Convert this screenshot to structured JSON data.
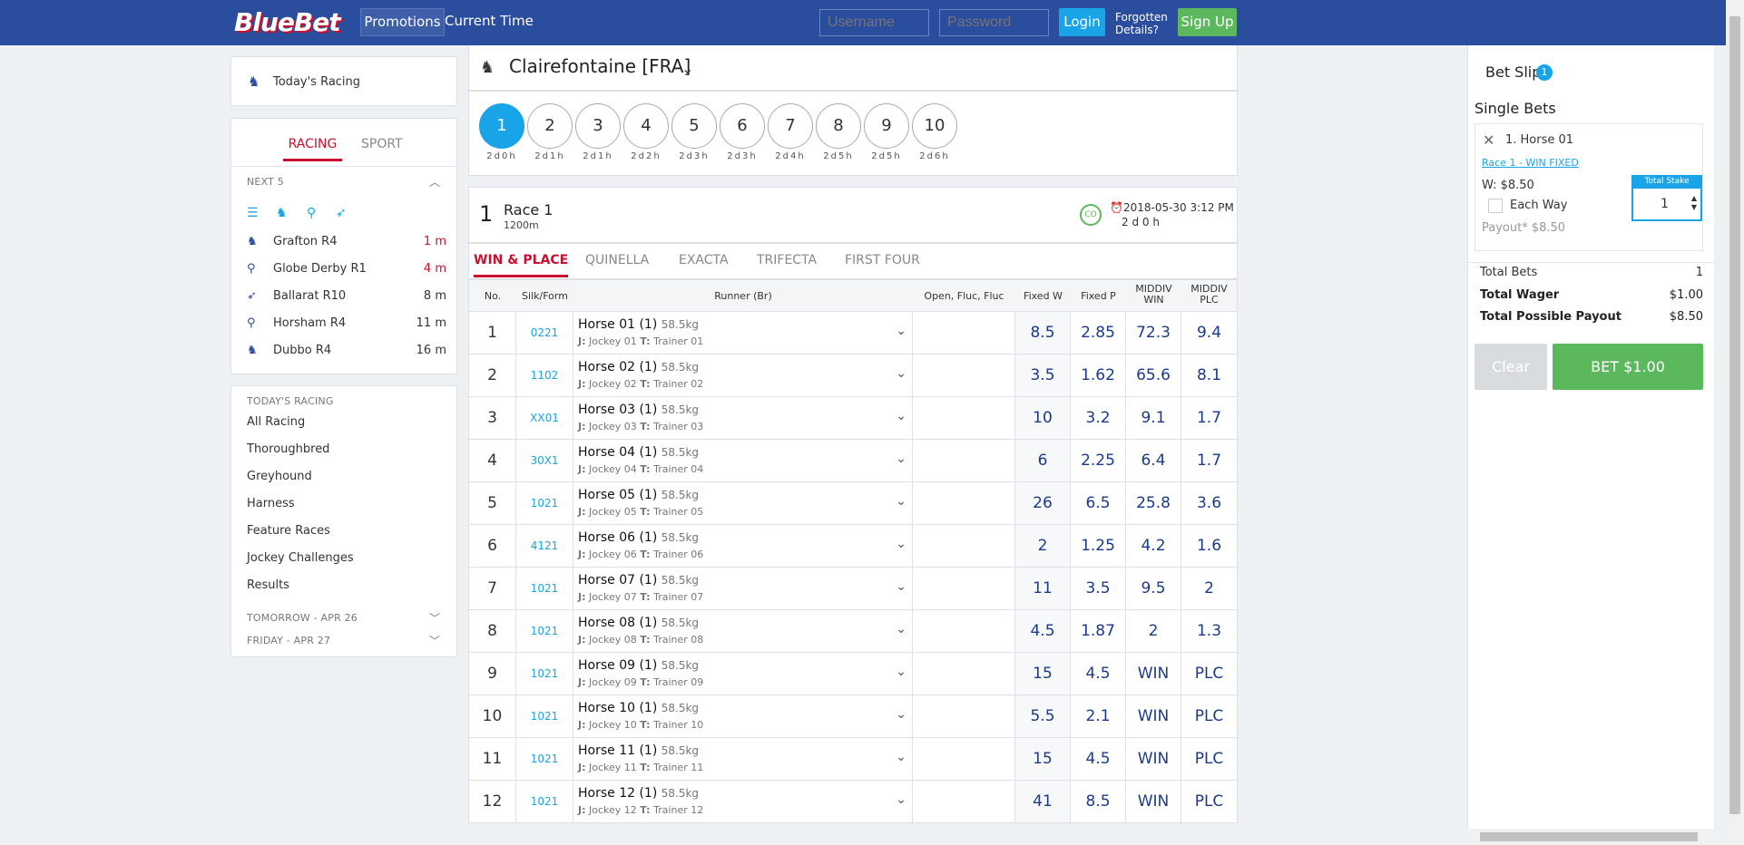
{
  "header": {
    "logo": "BlueBet",
    "promotions": "Promotions",
    "current_time": "Current Time",
    "username_ph": "Username",
    "password_ph": "Password",
    "login": "Login",
    "forgotten_1": "Forgotten",
    "forgotten_2": "Details?",
    "signup": "Sign Up"
  },
  "sidebar": {
    "todays_racing": "Today's Racing",
    "tab_racing": "RACING",
    "tab_sport": "SPORT",
    "next5_label": "NEXT 5",
    "next5": [
      {
        "name": "Grafton R4",
        "time": "1 m",
        "icon": "horse-icon",
        "urgent": true
      },
      {
        "name": "Globe Derby R1",
        "time": "4 m",
        "icon": "harness-icon",
        "urgent": true
      },
      {
        "name": "Ballarat R10",
        "time": "8 m",
        "icon": "greyhound-icon",
        "urgent": false
      },
      {
        "name": "Horsham R4",
        "time": "11 m",
        "icon": "harness-icon",
        "urgent": false
      },
      {
        "name": "Dubbo R4",
        "time": "16 m",
        "icon": "horse-icon",
        "urgent": false
      }
    ],
    "todays_label": "TODAY'S RACING",
    "links": [
      "All Racing",
      "Thoroughbred",
      "Greyhound",
      "Harness",
      "Feature Races",
      "Jockey Challenges",
      "Results"
    ],
    "tomorrow": "TOMORROW - APR 26",
    "friday": "FRIDAY - APR 27"
  },
  "venue": {
    "name": "Clairefontaine [FRA]"
  },
  "races": [
    {
      "n": "1",
      "t": "2d0h"
    },
    {
      "n": "2",
      "t": "2d1h"
    },
    {
      "n": "3",
      "t": "2d1h"
    },
    {
      "n": "4",
      "t": "2d2h"
    },
    {
      "n": "5",
      "t": "2d3h"
    },
    {
      "n": "6",
      "t": "2d3h"
    },
    {
      "n": "7",
      "t": "2d4h"
    },
    {
      "n": "8",
      "t": "2d5h"
    },
    {
      "n": "9",
      "t": "2d5h"
    },
    {
      "n": "10",
      "t": "2d6h"
    }
  ],
  "race": {
    "number": "1",
    "name": "Race 1",
    "distance": "1200m",
    "badge": "CO",
    "datetime": "2018-05-30 3:12 PM",
    "countdown": "2 d 0 h"
  },
  "bet_tabs": [
    "WIN & PLACE",
    "QUINELLA",
    "EXACTA",
    "TRIFECTA",
    "FIRST FOUR"
  ],
  "table_headers": {
    "no": "No.",
    "silk": "Silk/Form",
    "runner": "Runner (Br)",
    "fluc": "Open, Fluc, Fluc",
    "fw": "Fixed W",
    "fp": "Fixed P",
    "mw1": "MIDDIV",
    "mw2": "WIN",
    "mp1": "MIDDIV",
    "mp2": "PLC"
  },
  "runners": [
    {
      "no": "1",
      "form": "0221",
      "horse": "Horse 01 (1)",
      "weight": "58.5kg",
      "jockey": "Jockey 01",
      "trainer": "Trainer 01",
      "fw": "8.5",
      "fp": "2.85",
      "mw": "72.3",
      "mp": "9.4"
    },
    {
      "no": "2",
      "form": "1102",
      "horse": "Horse 02 (1)",
      "weight": "58.5kg",
      "jockey": "Jockey 02",
      "trainer": "Trainer 02",
      "fw": "3.5",
      "fp": "1.62",
      "mw": "65.6",
      "mp": "8.1"
    },
    {
      "no": "3",
      "form": "XX01",
      "horse": "Horse 03 (1)",
      "weight": "58.5kg",
      "jockey": "Jockey 03",
      "trainer": "Trainer 03",
      "fw": "10",
      "fp": "3.2",
      "mw": "9.1",
      "mp": "1.7"
    },
    {
      "no": "4",
      "form": "30X1",
      "horse": "Horse 04 (1)",
      "weight": "58.5kg",
      "jockey": "Jockey 04",
      "trainer": "Trainer 04",
      "fw": "6",
      "fp": "2.25",
      "mw": "6.4",
      "mp": "1.7"
    },
    {
      "no": "5",
      "form": "1021",
      "horse": "Horse 05 (1)",
      "weight": "58.5kg",
      "jockey": "Jockey 05",
      "trainer": "Trainer 05",
      "fw": "26",
      "fp": "6.5",
      "mw": "25.8",
      "mp": "3.6"
    },
    {
      "no": "6",
      "form": "4121",
      "horse": "Horse 06 (1)",
      "weight": "58.5kg",
      "jockey": "Jockey 06",
      "trainer": "Trainer 06",
      "fw": "2",
      "fp": "1.25",
      "mw": "4.2",
      "mp": "1.6"
    },
    {
      "no": "7",
      "form": "1021",
      "horse": "Horse 07 (1)",
      "weight": "58.5kg",
      "jockey": "Jockey 07",
      "trainer": "Trainer 07",
      "fw": "11",
      "fp": "3.5",
      "mw": "9.5",
      "mp": "2"
    },
    {
      "no": "8",
      "form": "1021",
      "horse": "Horse 08 (1)",
      "weight": "58.5kg",
      "jockey": "Jockey 08",
      "trainer": "Trainer 08",
      "fw": "4.5",
      "fp": "1.87",
      "mw": "2",
      "mp": "1.3"
    },
    {
      "no": "9",
      "form": "1021",
      "horse": "Horse 09 (1)",
      "weight": "58.5kg",
      "jockey": "Jockey 09",
      "trainer": "Trainer 09",
      "fw": "15",
      "fp": "4.5",
      "mw": "WIN",
      "mp": "PLC"
    },
    {
      "no": "10",
      "form": "1021",
      "horse": "Horse 10 (1)",
      "weight": "58.5kg",
      "jockey": "Jockey 10",
      "trainer": "Trainer 10",
      "fw": "5.5",
      "fp": "2.1",
      "mw": "WIN",
      "mp": "PLC"
    },
    {
      "no": "11",
      "form": "1021",
      "horse": "Horse 11 (1)",
      "weight": "58.5kg",
      "jockey": "Jockey 11",
      "trainer": "Trainer 11",
      "fw": "15",
      "fp": "4.5",
      "mw": "WIN",
      "mp": "PLC"
    },
    {
      "no": "12",
      "form": "1021",
      "horse": "Horse 12 (1)",
      "weight": "58.5kg",
      "jockey": "Jockey 12",
      "trainer": "Trainer 12",
      "fw": "41",
      "fp": "8.5",
      "mw": "WIN",
      "mp": "PLC"
    }
  ],
  "betslip": {
    "title": "Bet Slip",
    "count": "1",
    "single_bets": "Single Bets",
    "selection": "1. Horse 01",
    "race_link": "Race 1 - WIN FIXED",
    "win": "W: $8.50",
    "each_way": "Each Way",
    "payout": "Payout* $8.50",
    "stake_label": "Total Stake",
    "stake_value": "1",
    "total_bets_label": "Total Bets",
    "total_bets": "1",
    "total_wager_label": "Total Wager",
    "total_wager": "$1.00",
    "total_payout_label": "Total Possible Payout",
    "total_payout": "$8.50",
    "clear": "Clear",
    "bet": "BET $1.00"
  },
  "colors": {
    "brand": "#2b4d9d",
    "accent": "#1aa4e8",
    "alert": "#c8102e",
    "success": "#5cb85c"
  }
}
